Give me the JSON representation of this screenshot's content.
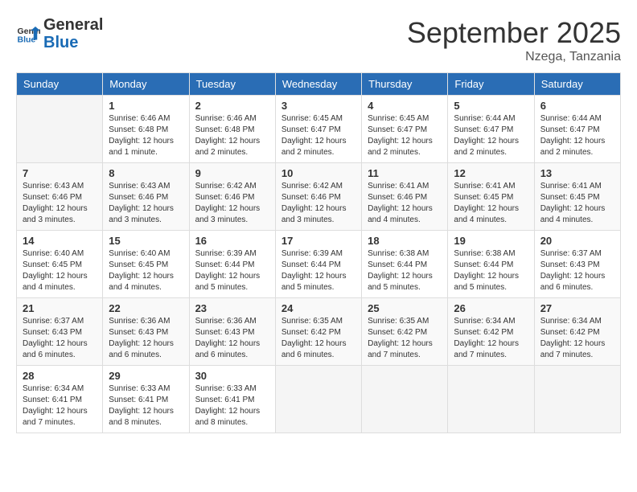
{
  "header": {
    "logo_line1": "General",
    "logo_line2": "Blue",
    "month": "September 2025",
    "location": "Nzega, Tanzania"
  },
  "columns": [
    "Sunday",
    "Monday",
    "Tuesday",
    "Wednesday",
    "Thursday",
    "Friday",
    "Saturday"
  ],
  "weeks": [
    [
      {
        "day": "",
        "info": ""
      },
      {
        "day": "1",
        "info": "Sunrise: 6:46 AM\nSunset: 6:48 PM\nDaylight: 12 hours\nand 1 minute."
      },
      {
        "day": "2",
        "info": "Sunrise: 6:46 AM\nSunset: 6:48 PM\nDaylight: 12 hours\nand 2 minutes."
      },
      {
        "day": "3",
        "info": "Sunrise: 6:45 AM\nSunset: 6:47 PM\nDaylight: 12 hours\nand 2 minutes."
      },
      {
        "day": "4",
        "info": "Sunrise: 6:45 AM\nSunset: 6:47 PM\nDaylight: 12 hours\nand 2 minutes."
      },
      {
        "day": "5",
        "info": "Sunrise: 6:44 AM\nSunset: 6:47 PM\nDaylight: 12 hours\nand 2 minutes."
      },
      {
        "day": "6",
        "info": "Sunrise: 6:44 AM\nSunset: 6:47 PM\nDaylight: 12 hours\nand 2 minutes."
      }
    ],
    [
      {
        "day": "7",
        "info": "Sunrise: 6:43 AM\nSunset: 6:46 PM\nDaylight: 12 hours\nand 3 minutes."
      },
      {
        "day": "8",
        "info": "Sunrise: 6:43 AM\nSunset: 6:46 PM\nDaylight: 12 hours\nand 3 minutes."
      },
      {
        "day": "9",
        "info": "Sunrise: 6:42 AM\nSunset: 6:46 PM\nDaylight: 12 hours\nand 3 minutes."
      },
      {
        "day": "10",
        "info": "Sunrise: 6:42 AM\nSunset: 6:46 PM\nDaylight: 12 hours\nand 3 minutes."
      },
      {
        "day": "11",
        "info": "Sunrise: 6:41 AM\nSunset: 6:46 PM\nDaylight: 12 hours\nand 4 minutes."
      },
      {
        "day": "12",
        "info": "Sunrise: 6:41 AM\nSunset: 6:45 PM\nDaylight: 12 hours\nand 4 minutes."
      },
      {
        "day": "13",
        "info": "Sunrise: 6:41 AM\nSunset: 6:45 PM\nDaylight: 12 hours\nand 4 minutes."
      }
    ],
    [
      {
        "day": "14",
        "info": "Sunrise: 6:40 AM\nSunset: 6:45 PM\nDaylight: 12 hours\nand 4 minutes."
      },
      {
        "day": "15",
        "info": "Sunrise: 6:40 AM\nSunset: 6:45 PM\nDaylight: 12 hours\nand 4 minutes."
      },
      {
        "day": "16",
        "info": "Sunrise: 6:39 AM\nSunset: 6:44 PM\nDaylight: 12 hours\nand 5 minutes."
      },
      {
        "day": "17",
        "info": "Sunrise: 6:39 AM\nSunset: 6:44 PM\nDaylight: 12 hours\nand 5 minutes."
      },
      {
        "day": "18",
        "info": "Sunrise: 6:38 AM\nSunset: 6:44 PM\nDaylight: 12 hours\nand 5 minutes."
      },
      {
        "day": "19",
        "info": "Sunrise: 6:38 AM\nSunset: 6:44 PM\nDaylight: 12 hours\nand 5 minutes."
      },
      {
        "day": "20",
        "info": "Sunrise: 6:37 AM\nSunset: 6:43 PM\nDaylight: 12 hours\nand 6 minutes."
      }
    ],
    [
      {
        "day": "21",
        "info": "Sunrise: 6:37 AM\nSunset: 6:43 PM\nDaylight: 12 hours\nand 6 minutes."
      },
      {
        "day": "22",
        "info": "Sunrise: 6:36 AM\nSunset: 6:43 PM\nDaylight: 12 hours\nand 6 minutes."
      },
      {
        "day": "23",
        "info": "Sunrise: 6:36 AM\nSunset: 6:43 PM\nDaylight: 12 hours\nand 6 minutes."
      },
      {
        "day": "24",
        "info": "Sunrise: 6:35 AM\nSunset: 6:42 PM\nDaylight: 12 hours\nand 6 minutes."
      },
      {
        "day": "25",
        "info": "Sunrise: 6:35 AM\nSunset: 6:42 PM\nDaylight: 12 hours\nand 7 minutes."
      },
      {
        "day": "26",
        "info": "Sunrise: 6:34 AM\nSunset: 6:42 PM\nDaylight: 12 hours\nand 7 minutes."
      },
      {
        "day": "27",
        "info": "Sunrise: 6:34 AM\nSunset: 6:42 PM\nDaylight: 12 hours\nand 7 minutes."
      }
    ],
    [
      {
        "day": "28",
        "info": "Sunrise: 6:34 AM\nSunset: 6:41 PM\nDaylight: 12 hours\nand 7 minutes."
      },
      {
        "day": "29",
        "info": "Sunrise: 6:33 AM\nSunset: 6:41 PM\nDaylight: 12 hours\nand 8 minutes."
      },
      {
        "day": "30",
        "info": "Sunrise: 6:33 AM\nSunset: 6:41 PM\nDaylight: 12 hours\nand 8 minutes."
      },
      {
        "day": "",
        "info": ""
      },
      {
        "day": "",
        "info": ""
      },
      {
        "day": "",
        "info": ""
      },
      {
        "day": "",
        "info": ""
      }
    ]
  ]
}
